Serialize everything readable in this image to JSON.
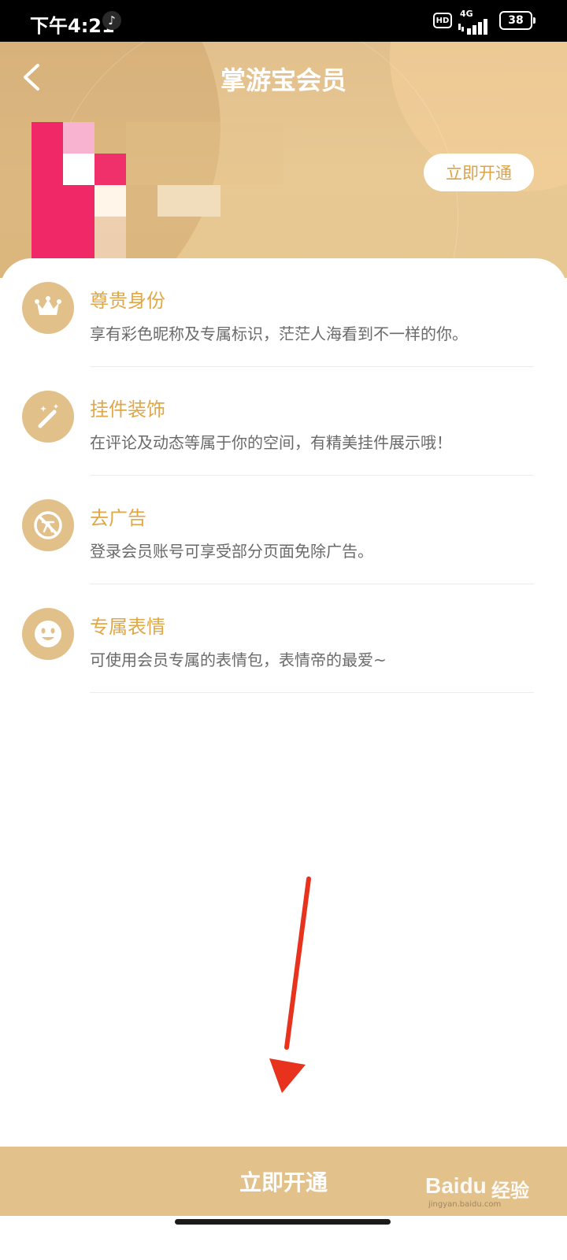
{
  "status_bar": {
    "time": "下午4:21",
    "hd": "HD",
    "network": "4G",
    "battery": "38"
  },
  "header": {
    "title": "掌游宝会员",
    "back_icon": "chevron-left-icon",
    "activate_label": "立即开通"
  },
  "benefits": [
    {
      "title": "尊贵身份",
      "desc": "享有彩色昵称及专属标识，茫茫人海看到不一样的你。",
      "icon": "crown-icon"
    },
    {
      "title": "挂件装饰",
      "desc": "在评论及动态等属于你的空间，有精美挂件展示哦！",
      "icon": "magic-wand-icon"
    },
    {
      "title": "去广告",
      "desc": "登录会员账号可享受部分页面免除广告。",
      "icon": "no-ads-icon"
    },
    {
      "title": "专属表情",
      "desc": "可使用会员专属的表情包，表情帝的最爱~",
      "icon": "smiley-icon"
    }
  ],
  "footer": {
    "activate_label": "立即开通",
    "watermark_brand": "Baidu",
    "watermark_suffix": "经验",
    "watermark_url": "jingyan.baidu.com"
  },
  "colors": {
    "accent": "#e1a746",
    "gold": "#e2c08a",
    "arrow": "#e8321e"
  }
}
